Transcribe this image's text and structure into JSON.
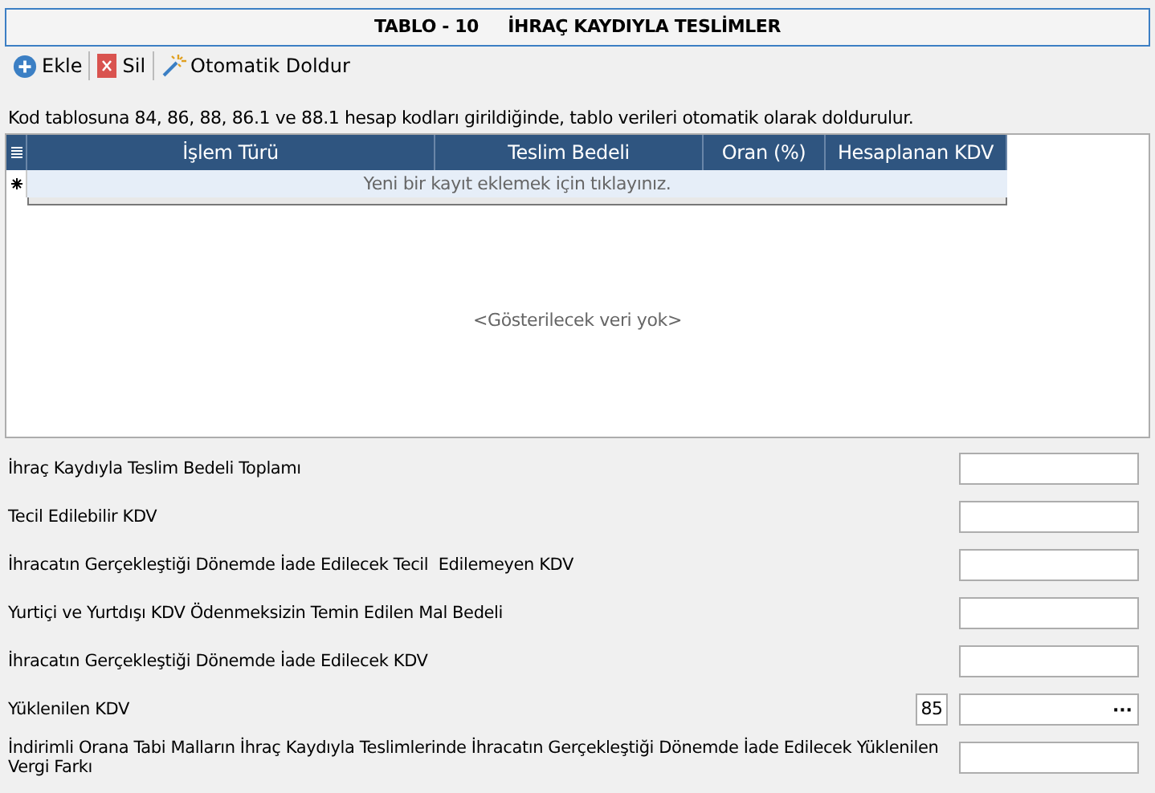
{
  "title": "TABLO - 10     İHRAÇ KAYDIYLA TESLİMLER",
  "toolbar": [
    {
      "kind": "add",
      "label": "Ekle"
    },
    {
      "kind": "delete",
      "label": "Sil"
    },
    {
      "kind": "autofill",
      "label": "Otomatik Doldur"
    }
  ],
  "info": "Kod tablosuna 84, 86, 88, 86.1 ve 88.1 hesap kodları girildiğinde, tablo verileri otomatik olarak doldurulur.",
  "grid": {
    "columns": [
      "İşlem Türü",
      "Teslim Bedeli",
      "Oran (%)",
      "Hesaplanan KDV"
    ],
    "new_row_text": "Yeni bir kayıt eklemek için tıklayınız.",
    "empty_text": "<Gösterilecek veri yok>"
  },
  "fields": [
    {
      "kind": "plain",
      "label": "İhraç Kaydıyla Teslim Bedeli Toplamı"
    },
    {
      "kind": "plain",
      "label": "Tecil Edilebilir KDV"
    },
    {
      "kind": "plain",
      "label": "İhracatın Gerçekleştiği Dönemde İade Edilecek Tecil  Edilemeyen KDV"
    },
    {
      "kind": "plain",
      "label": "Yurtiçi ve Yurtdışı KDV Ödenmeksizin Temin Edilen Mal Bedeli"
    },
    {
      "kind": "plain",
      "label": "İhracatın Gerçekleştiği Dönemde İade Edilecek KDV"
    },
    {
      "kind": "lookup",
      "label": "Yüklenilen KDV",
      "code": "85",
      "button": "···"
    },
    {
      "kind": "plain",
      "label": "İndirimli Orana Tabi Malların İhraç Kaydıyla Teslimlerinde İhracatın Gerçekleştiği Dönemde İade Edilecek Yüklenilen Vergi Farkı"
    }
  ]
}
